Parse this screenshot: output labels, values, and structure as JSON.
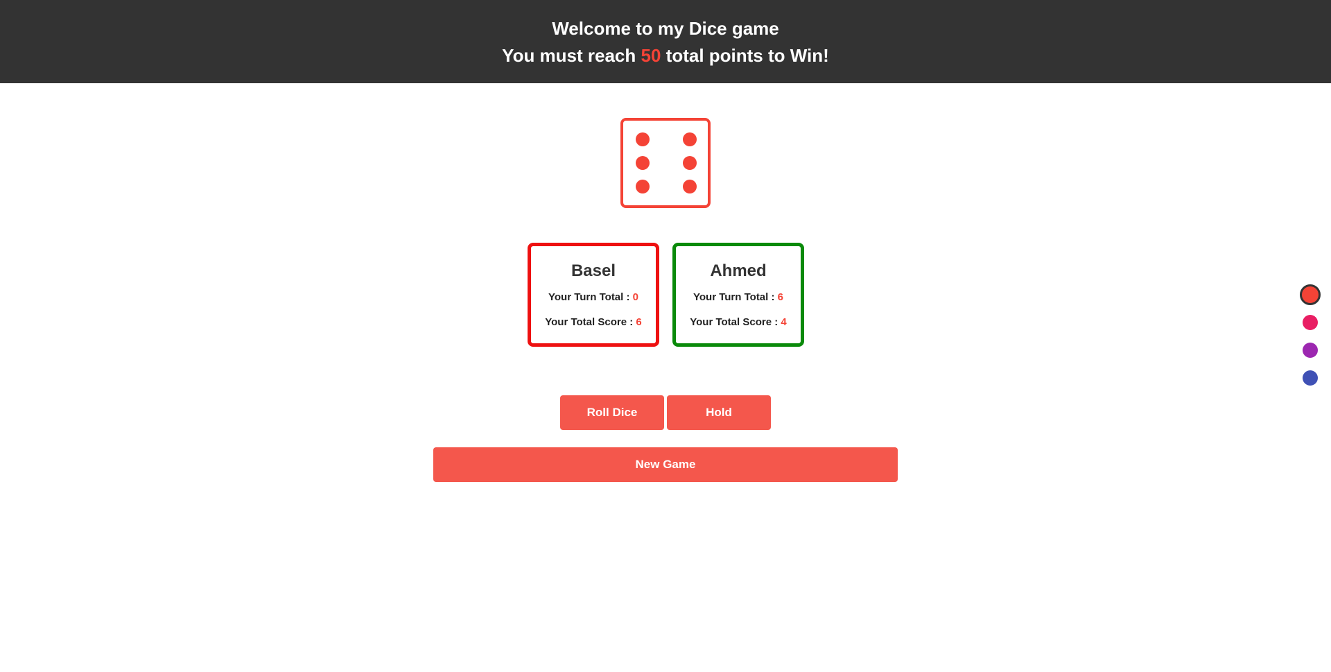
{
  "header": {
    "welcome": "Welcome to my Dice game",
    "goal_prefix": "You must reach ",
    "goal_points": "50",
    "goal_suffix": " total points to Win!"
  },
  "dice": {
    "value": 6,
    "icon": "dice-six-icon",
    "color": "#f44336"
  },
  "players": [
    {
      "name": "Basel",
      "turn_total_label": "Your Turn Total :",
      "turn_total": "0",
      "total_score_label": "Your Total Score :",
      "total_score": "6",
      "border_color": "#ee1111"
    },
    {
      "name": "Ahmed",
      "turn_total_label": "Your Turn Total :",
      "turn_total": "6",
      "total_score_label": "Your Total Score :",
      "total_score": "4",
      "border_color": "#0a8a0a"
    }
  ],
  "controls": {
    "roll_label": "Roll Dice",
    "hold_label": "Hold",
    "new_game_label": "New Game"
  },
  "theme_swatches": [
    {
      "color": "#f44336",
      "selected": true
    },
    {
      "color": "#e91e63",
      "selected": false
    },
    {
      "color": "#9c27b0",
      "selected": false
    },
    {
      "color": "#3f51b5",
      "selected": false
    }
  ]
}
